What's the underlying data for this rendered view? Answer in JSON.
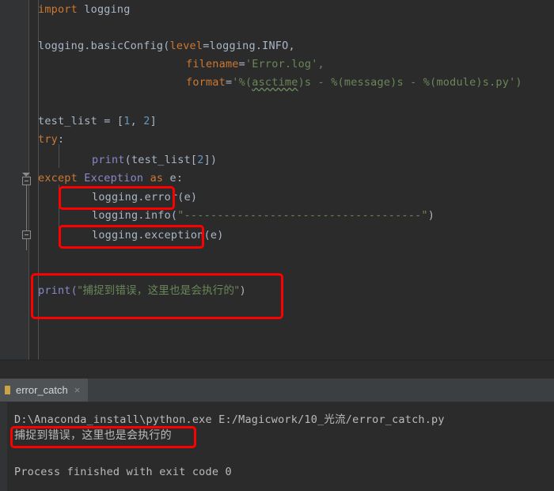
{
  "editor": {
    "lines": [
      {
        "id": "l1",
        "text": "import logging"
      },
      {
        "id": "l2",
        "text": "logging.basicConfig(level=logging.INFO,"
      },
      {
        "id": "l3",
        "text": "filename='Error.log',"
      },
      {
        "id": "l4",
        "text": "format='%(asctime)s - %(message)s - %(module)s.py')"
      },
      {
        "id": "l5",
        "text": "test_list = [1, 2]"
      },
      {
        "id": "l6",
        "text": "try:"
      },
      {
        "id": "l7",
        "text": "    print(test_list[2])"
      },
      {
        "id": "l8",
        "text": "except Exception as e:"
      },
      {
        "id": "l9",
        "text": "    logging.error(e)"
      },
      {
        "id": "l10",
        "text": "    logging.info(\"------------------------------------\")"
      },
      {
        "id": "l11",
        "text": "    logging.exception(e)"
      },
      {
        "id": "l12",
        "text": "print(\"捕捉到错误，这里也是会执行的\")"
      }
    ],
    "tokens": {
      "kw_import": "import",
      "mod_logging": " logging",
      "call_basicconfig": "logging.basicConfig(",
      "arg_level": "level",
      "eq": "=",
      "val_level": "logging.INFO,",
      "arg_filename": "filename",
      "str_filename": "'Error.log',",
      "arg_format": "format",
      "str_format_open": "'%(",
      "str_format_asctime": "asctime",
      "str_format_rest": ")s - %(message)s - %(module)s.py')",
      "testlist_assign": "test_list = [",
      "num_one": "1",
      "comma_space": ", ",
      "num_two": "2",
      "bracket_close": "]",
      "kw_try": "try",
      "colon": ":",
      "bi_print": "print",
      "print_args": "(test_list[",
      "num_index": "2",
      "print_args_close": "])",
      "kw_except": "except",
      "cls_exception": " Exception ",
      "kw_as": "as",
      "var_e": " e:",
      "log_error": "logging.error(e)",
      "log_info_head": "logging.info(",
      "log_info_str": "\"------------------------------------\"",
      "log_info_tail": ")",
      "log_exception": "logging.exception(e)",
      "print_cn_head": "print(",
      "print_cn_str": "\"捕捉到错误，这里也是会执行的\"",
      "print_cn_tail": ")"
    }
  },
  "annotations": {
    "box1_label": "logging.error(e)",
    "box2_label": "logging.exception(e)",
    "box3_label": "print(\"捕捉到错误，这里也是会执行的\")",
    "box4_label": "捕捉到错误，这里也是会执行的",
    "color": "#ff0000"
  },
  "console": {
    "tab": {
      "label": "error_catch",
      "close_glyph": "×",
      "icon": "run-configuration-icon"
    },
    "output": [
      {
        "id": "c1",
        "text": "D:\\Anaconda_install\\python.exe E:/Magicwork/10_光流/error_catch.py",
        "cjk": false
      },
      {
        "id": "c2",
        "text": "捕捉到错误，这里也是会执行的",
        "cjk": true
      },
      {
        "id": "c3",
        "text": "Process finished with exit code 0",
        "cjk": false
      }
    ]
  },
  "theme": {
    "editor_bg": "#2b2b2b",
    "gutter_bg": "#313335",
    "console_bg": "#2b2b2b",
    "tabbar_bg": "#3c3f41",
    "tab_active_bg": "#4e5254",
    "text": "#a9b7c6",
    "keyword": "#cc7832",
    "string": "#6a8759",
    "number": "#6897bb",
    "builtin": "#8888c6",
    "console_text": "#bbbbbb",
    "annotation": "#ff0000"
  }
}
